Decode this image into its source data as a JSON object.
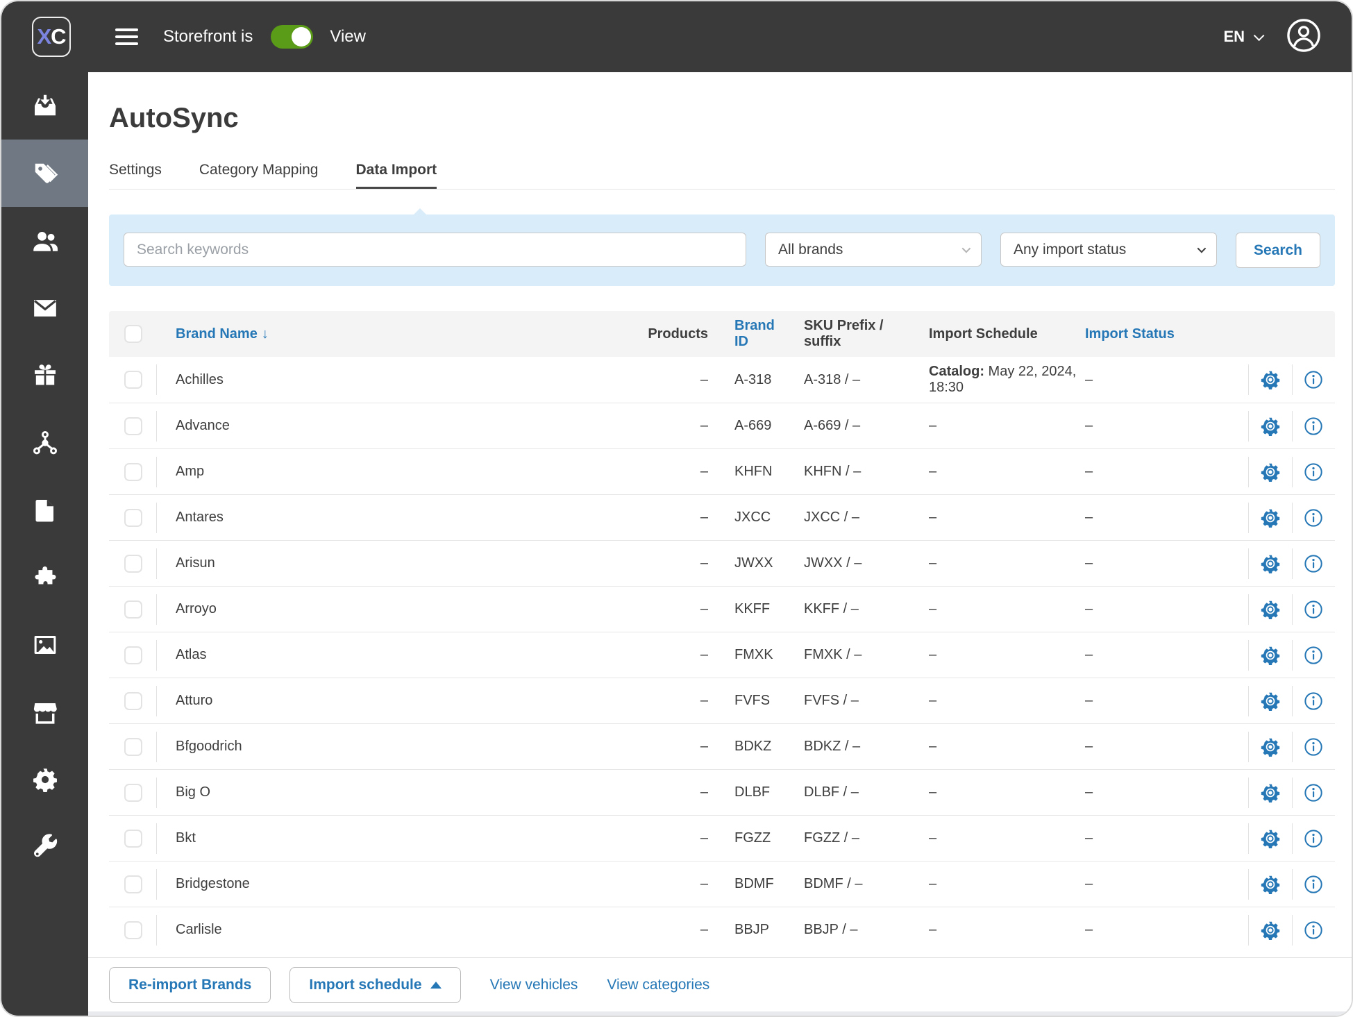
{
  "topbar": {
    "logo_text": "XC",
    "storefront_label": "Storefront is",
    "storefront_toggle": "on",
    "view_label": "View",
    "language": "EN"
  },
  "sidebar": {
    "active_index": 1,
    "items": [
      {
        "label": "orders",
        "icon": "inbox-import-icon"
      },
      {
        "label": "catalog",
        "icon": "tag-icon"
      },
      {
        "label": "customers",
        "icon": "users-icon"
      },
      {
        "label": "messages",
        "icon": "envelope-icon"
      },
      {
        "label": "promotions",
        "icon": "gift-icon"
      },
      {
        "label": "integrations",
        "icon": "hub-icon"
      },
      {
        "label": "pages",
        "icon": "file-icon"
      },
      {
        "label": "addons",
        "icon": "puzzle-icon"
      },
      {
        "label": "media",
        "icon": "image-icon"
      },
      {
        "label": "storefront",
        "icon": "store-icon"
      },
      {
        "label": "settings",
        "icon": "gear-icon"
      },
      {
        "label": "tools",
        "icon": "wrench-icon"
      }
    ]
  },
  "page": {
    "title": "AutoSync",
    "tabs": [
      {
        "label": "Settings",
        "active": false
      },
      {
        "label": "Category Mapping",
        "active": false
      },
      {
        "label": "Data Import",
        "active": true
      }
    ]
  },
  "filters": {
    "search_placeholder": "Search keywords",
    "brand_select_value": "All brands",
    "status_select_value": "Any import status",
    "search_button_label": "Search"
  },
  "table": {
    "columns": {
      "name": "Brand Name",
      "products": "Products",
      "brand_id": "Brand ID",
      "sku": "SKU Prefix / suffix",
      "schedule": "Import Schedule",
      "status": "Import Status"
    },
    "sort_indicator": "↓",
    "rows": [
      {
        "name": "Achilles",
        "products": "–",
        "brand_id": "A-318",
        "sku": "A-318 / –",
        "schedule_label": "Catalog:",
        "schedule_value": " May 22, 2024, 18:30",
        "status": "–"
      },
      {
        "name": "Advance",
        "products": "–",
        "brand_id": "A-669",
        "sku": "A-669 / –",
        "schedule_label": "",
        "schedule_value": "–",
        "status": "–"
      },
      {
        "name": "Amp",
        "products": "–",
        "brand_id": "KHFN",
        "sku": "KHFN / –",
        "schedule_label": "",
        "schedule_value": "–",
        "status": "–"
      },
      {
        "name": "Antares",
        "products": "–",
        "brand_id": "JXCC",
        "sku": "JXCC / –",
        "schedule_label": "",
        "schedule_value": "–",
        "status": "–"
      },
      {
        "name": "Arisun",
        "products": "–",
        "brand_id": "JWXX",
        "sku": "JWXX / –",
        "schedule_label": "",
        "schedule_value": "–",
        "status": "–"
      },
      {
        "name": "Arroyo",
        "products": "–",
        "brand_id": "KKFF",
        "sku": "KKFF / –",
        "schedule_label": "",
        "schedule_value": "–",
        "status": "–"
      },
      {
        "name": "Atlas",
        "products": "–",
        "brand_id": "FMXK",
        "sku": "FMXK / –",
        "schedule_label": "",
        "schedule_value": "–",
        "status": "–"
      },
      {
        "name": "Atturo",
        "products": "–",
        "brand_id": "FVFS",
        "sku": "FVFS / –",
        "schedule_label": "",
        "schedule_value": "–",
        "status": "–"
      },
      {
        "name": "Bfgoodrich",
        "products": "–",
        "brand_id": "BDKZ",
        "sku": "BDKZ / –",
        "schedule_label": "",
        "schedule_value": "–",
        "status": "–"
      },
      {
        "name": "Big O",
        "products": "–",
        "brand_id": "DLBF",
        "sku": "DLBF / –",
        "schedule_label": "",
        "schedule_value": "–",
        "status": "–"
      },
      {
        "name": "Bkt",
        "products": "–",
        "brand_id": "FGZZ",
        "sku": "FGZZ / –",
        "schedule_label": "",
        "schedule_value": "–",
        "status": "–"
      },
      {
        "name": "Bridgestone",
        "products": "–",
        "brand_id": "BDMF",
        "sku": "BDMF / –",
        "schedule_label": "",
        "schedule_value": "–",
        "status": "–"
      },
      {
        "name": "Carlisle",
        "products": "–",
        "brand_id": "BBJP",
        "sku": "BBJP / –",
        "schedule_label": "",
        "schedule_value": "–",
        "status": "–"
      }
    ]
  },
  "footer": {
    "reimport_button": "Re-import Brands",
    "schedule_button": "Import schedule",
    "view_vehicles_link": "View vehicles",
    "view_categories_link": "View categories"
  },
  "colors": {
    "accent_blue": "#2577b6",
    "topbar_bg": "#3a3a3a",
    "sidebar_active_bg": "#6f7883",
    "filter_bg": "#d9ecfa",
    "toggle_green": "#5a9b17",
    "logo_x_blue": "#7b85e0"
  }
}
